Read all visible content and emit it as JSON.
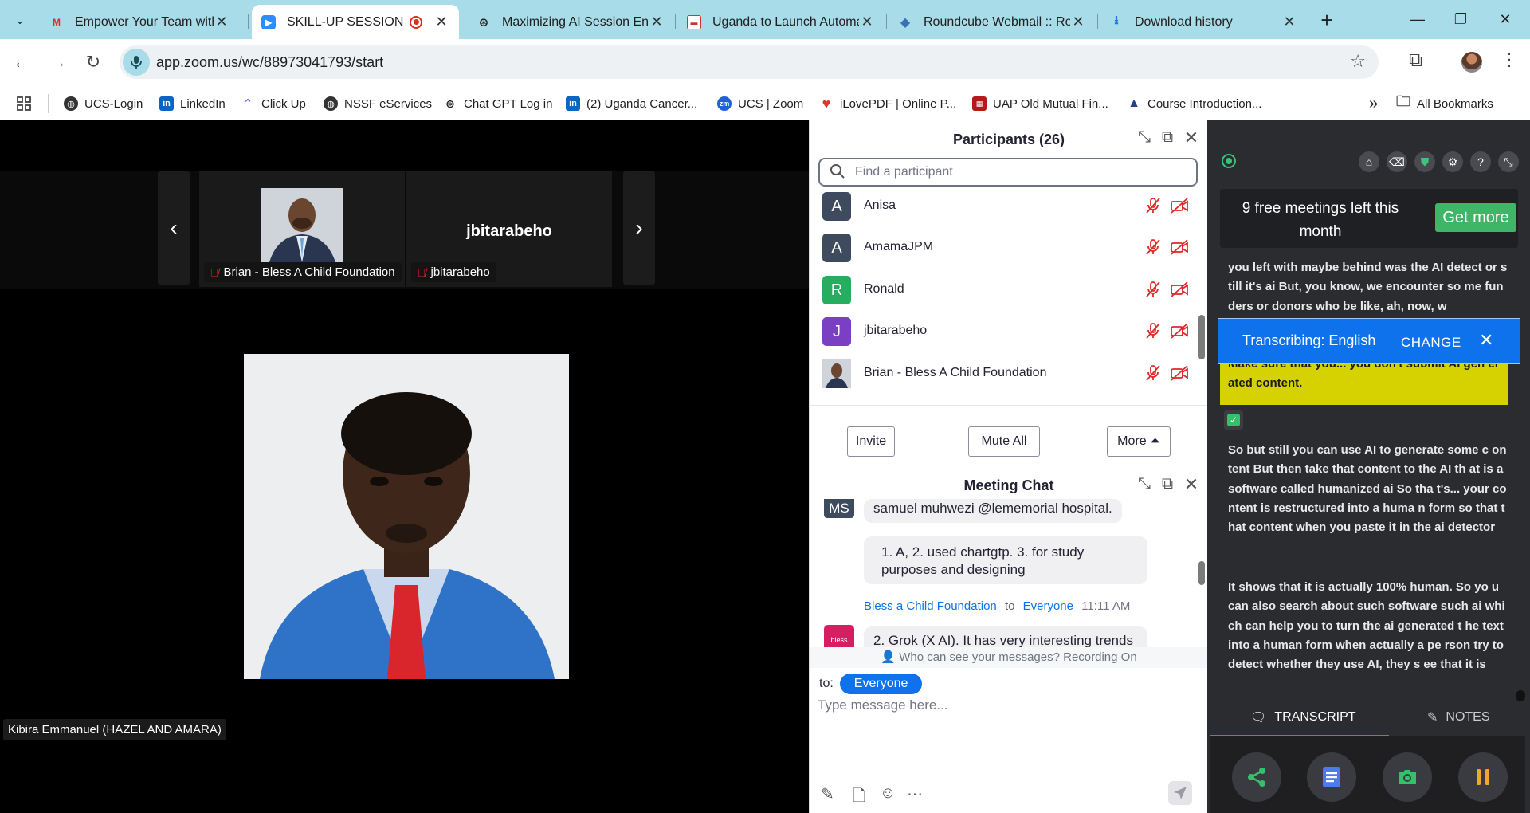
{
  "browser": {
    "tabs": [
      {
        "title": "Empower Your Team with L",
        "favicon": "gmail-icon"
      },
      {
        "title": "SKILL-UP SESSION",
        "favicon": "zoom-icon",
        "active": true
      },
      {
        "title": "Maximizing AI Session Eng",
        "favicon": "chatgpt-icon"
      },
      {
        "title": "Uganda to Launch Automa",
        "favicon": "news-icon"
      },
      {
        "title": "Roundcube Webmail :: Re",
        "favicon": "roundcube-icon"
      },
      {
        "title": "Download history",
        "favicon": "download-icon"
      }
    ],
    "url": "app.zoom.us/wc/88973041793/start",
    "bookmarks": [
      {
        "label": "UCS-Login",
        "icon": "globe-icon"
      },
      {
        "label": "LinkedIn",
        "icon": "linkedin-icon"
      },
      {
        "label": "Click Up",
        "icon": "clickup-icon"
      },
      {
        "label": "NSSF eServices",
        "icon": "globe-icon"
      },
      {
        "label": "Chat GPT Log in",
        "icon": "chatgpt-icon"
      },
      {
        "label": "(2) Uganda Cancer...",
        "icon": "linkedin-icon"
      },
      {
        "label": "UCS | Zoom",
        "icon": "zoom-icon"
      },
      {
        "label": "iLovePDF | Online P...",
        "icon": "heart-icon"
      },
      {
        "label": "UAP Old Mutual Fin...",
        "icon": "uap-icon"
      },
      {
        "label": "Course Introduction...",
        "icon": "course-icon"
      }
    ],
    "all_bookmarks": "All Bookmarks"
  },
  "video": {
    "tiles": [
      {
        "name": "Brian - Bless A Child Foundation"
      },
      {
        "name": "jbitarabeho",
        "big_label": "jbitarabeho"
      }
    ],
    "main_speaker": "Kibira Emmanuel (HAZEL AND AMARA)"
  },
  "participants": {
    "title": "Participants (26)",
    "search_placeholder": "Find a participant",
    "list": [
      {
        "initial": "A",
        "name": "Anisa",
        "color": "#3e4a5e"
      },
      {
        "initial": "A",
        "name": "AmamaJPM",
        "color": "#3e4a5e"
      },
      {
        "initial": "R",
        "name": "Ronald",
        "color": "#26ad5f"
      },
      {
        "initial": "J",
        "name": "jbitarabeho",
        "color": "#7b3fc4"
      },
      {
        "initial": "",
        "name": "Brian - Bless A Child Foundation",
        "color": "#2a2f3a"
      }
    ],
    "buttons": {
      "invite": "Invite",
      "mute_all": "Mute All",
      "more": "More ⏶"
    }
  },
  "chat": {
    "title": "Meeting Chat",
    "messages": [
      {
        "avatar": "MS",
        "text": "samuel muhwezi @lememorial hospital."
      },
      {
        "text": "1. A, 2. used chartgtp. 3. for study purposes and designing"
      },
      {
        "sender": "Bless a Child Foundation",
        "to_word": "to",
        "recipient": "Everyone",
        "time": "11:11 AM",
        "avatar": "bless",
        "text": "2. Grok (X AI). It has very interesting trends"
      }
    ],
    "visibility": "Who can see your messages? Recording On",
    "to_label": "to:",
    "to_value": "Everyone",
    "input_placeholder": "Type message here..."
  },
  "extension": {
    "free_text": "9 free meetings left this month",
    "get_more": "Get more",
    "transcript_1": "you left with maybe behind was the AI detect or still it's ai But, you know, we encounter so me funders or donors who be like, ah, now, w",
    "banner_label": "Transcribing: English",
    "banner_change": "CHANGE",
    "highlight": "Make sure that you... you don't submit AI gen erated content.",
    "transcript_2": "So but still you can use AI to generate some c ontent But then take that content to the AI th at is a software called humanized ai So tha t's... your content is restructured into a huma n form so that that content when you paste it in the ai detector",
    "transcript_3": "It shows that it is actually 100% human. So yo u can also search about such software such ai which can help you to turn the ai generated t he text into a human form when actually a pe rson try to detect whether they use AI, they s ee that it is",
    "tab_transcript": "TRANSCRIPT",
    "tab_notes": "NOTES"
  }
}
